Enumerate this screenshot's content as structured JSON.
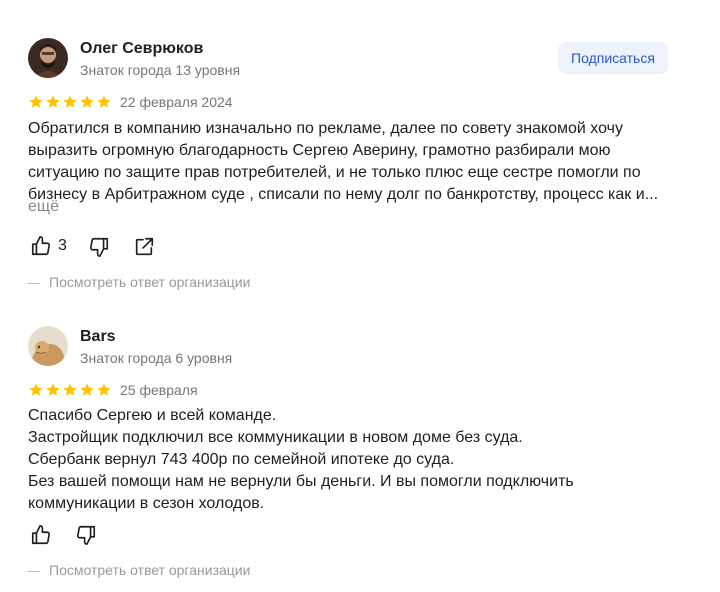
{
  "reviews": [
    {
      "author": "Олег Севрюков",
      "level": "Знаток города 13 уровня",
      "subscribe_label": "Подписаться",
      "rating": 5,
      "date": "22 февраля 2024",
      "text": "Обратился в компанию изначально по рекламе, далее по совету знакомой хочу\nвыразить огромную благодарность Сергею Аверину, грамотно разбирали мою\nситуацию по защите прав потребителей, и не только плюс еще сестре помогли по\nбизнесу в Арбитражном суде , списали по нему долг по банкротству, процесс как и...",
      "more_label": "ещё",
      "likes": "3",
      "reply_label": "Посмотреть ответ организации"
    },
    {
      "author": "Bars",
      "level": "Знаток города 6 уровня",
      "rating": 5,
      "date": "25 февраля",
      "text": "Спасибо Сергею и всей команде.\nЗастройщик подключил все коммуникации в новом доме без суда.\nСбербанк вернул 743 400р по семейной ипотеке до суда.\nБез вашей помощи нам не вернули бы деньги. И вы помогли подключить\nкоммуникации в сезон холодов.",
      "reply_label": "Посмотреть ответ организации"
    }
  ],
  "colors": {
    "star": "#fcc500",
    "accent": "#2b57d6"
  }
}
